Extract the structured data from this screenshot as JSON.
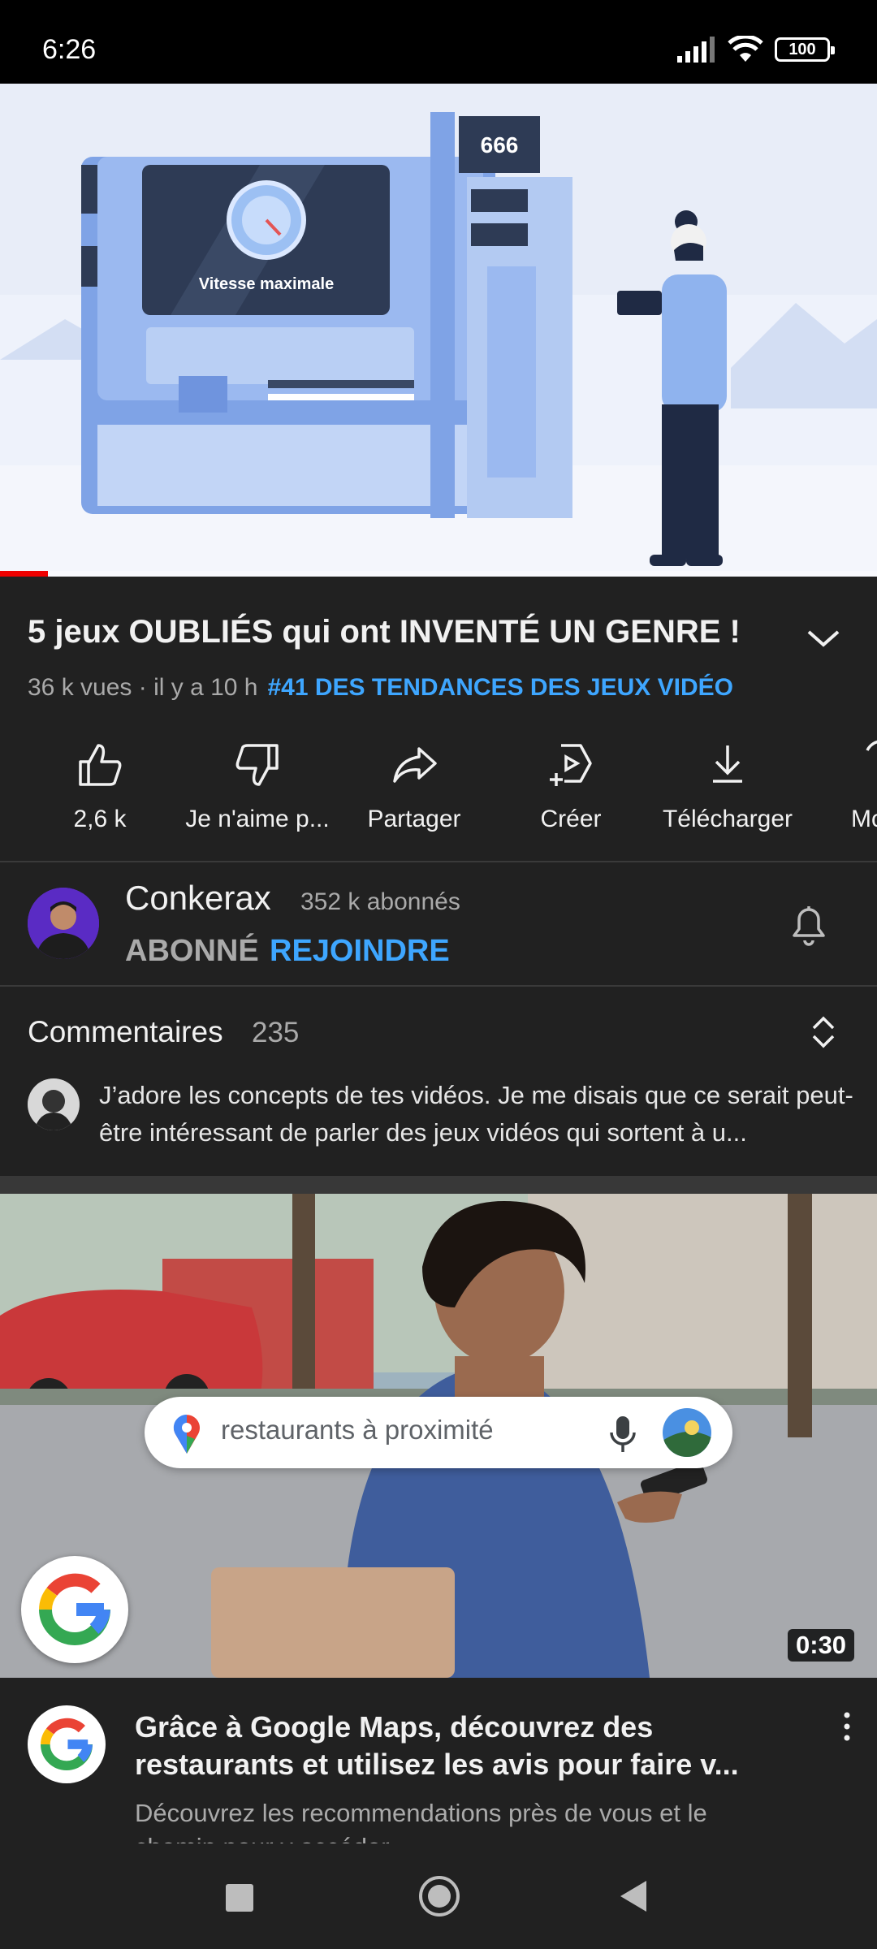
{
  "status_bar": {
    "time": "6:26",
    "battery": "100"
  },
  "player": {
    "screen_label": "Vitesse maximale",
    "counter": "666",
    "progress": 0.055,
    "progress_color": "#ee0000"
  },
  "video": {
    "title": "5 jeux OUBLIÉS qui ont INVENTÉ UN GENRE !",
    "meta": "36 k vues · il y a 10 h",
    "trending": "#41 DES TENDANCES DES JEUX VIDÉO"
  },
  "actions": [
    {
      "label": "2,6 k",
      "icon": "thumbs-up-icon"
    },
    {
      "label": "Je n'aime p...",
      "icon": "thumbs-down-icon"
    },
    {
      "label": "Partager",
      "icon": "share-icon"
    },
    {
      "label": "Créer",
      "icon": "create-icon"
    },
    {
      "label": "Télécharger",
      "icon": "download-icon"
    },
    {
      "label": "Mo",
      "icon": "save-icon"
    }
  ],
  "channel": {
    "name": "Conkerax",
    "subscribers": "352 k abonnés",
    "subscribed_label": "ABONNÉ",
    "join_label": "REJOINDRE"
  },
  "comments": {
    "label": "Commentaires",
    "count": "235",
    "top_comment": "J’adore les concepts de tes vidéos. Je me disais que ce serait peut-être intéressant de parler des jeux vidéos qui sortent à u..."
  },
  "ad": {
    "search_text": "restaurants à proximité",
    "duration": "0:30",
    "title": "Grâce à Google Maps, découvrez des restaurants et utilisez les avis pour faire v...",
    "description": "Découvrez les recommendations près de vous et le chemin pour y accéder"
  },
  "colors": {
    "accent_blue": "#3ea6ff",
    "background": "#212121"
  }
}
